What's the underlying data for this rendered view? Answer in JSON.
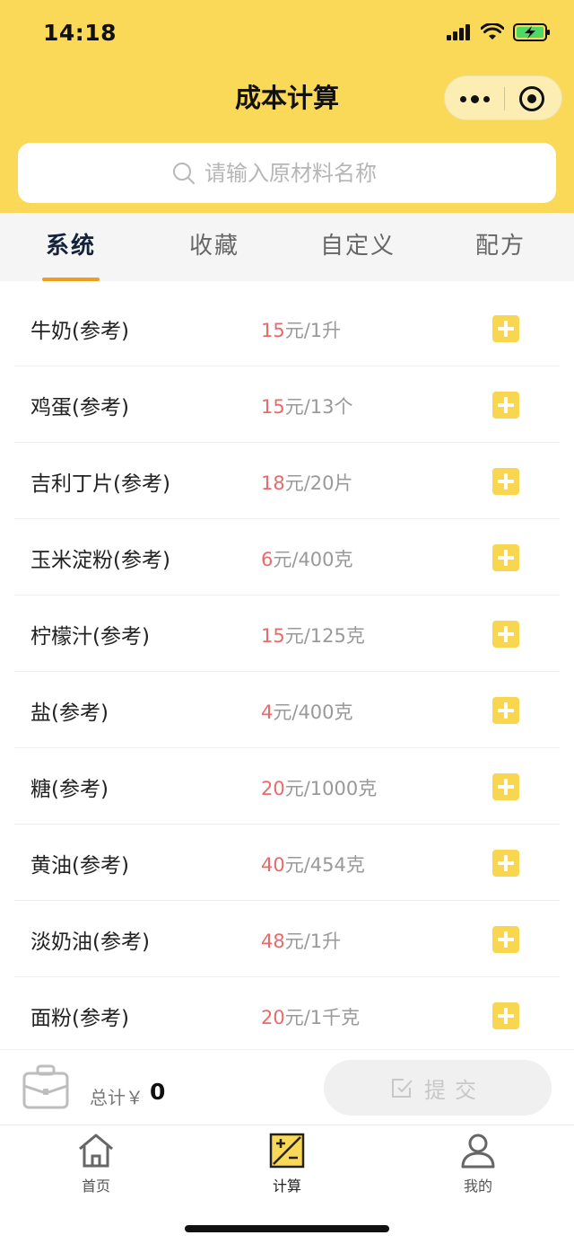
{
  "status_bar": {
    "time": "14:18"
  },
  "header": {
    "title": "成本计算"
  },
  "search": {
    "placeholder": "请输入原材料名称"
  },
  "tabs": [
    {
      "label": "系统",
      "active": true
    },
    {
      "label": "收藏",
      "active": false
    },
    {
      "label": "自定义",
      "active": false
    },
    {
      "label": "配方",
      "active": false
    }
  ],
  "materials": [
    {
      "name": "牛奶(参考)",
      "price": "15",
      "unit": "元/1升"
    },
    {
      "name": "鸡蛋(参考)",
      "price": "15",
      "unit": "元/13个"
    },
    {
      "name": "吉利丁片(参考)",
      "price": "18",
      "unit": "元/20片"
    },
    {
      "name": "玉米淀粉(参考)",
      "price": "6",
      "unit": "元/400克"
    },
    {
      "name": "柠檬汁(参考)",
      "price": "15",
      "unit": "元/125克"
    },
    {
      "name": "盐(参考)",
      "price": "4",
      "unit": "元/400克"
    },
    {
      "name": "糖(参考)",
      "price": "20",
      "unit": "元/1000克"
    },
    {
      "name": "黄油(参考)",
      "price": "40",
      "unit": "元/454克"
    },
    {
      "name": "淡奶油(参考)",
      "price": "48",
      "unit": "元/1升"
    },
    {
      "name": "面粉(参考)",
      "price": "20",
      "unit": "元/1千克"
    }
  ],
  "cart": {
    "total_label": "总计￥",
    "total_value": "0",
    "submit_label": "提交"
  },
  "tabbar": [
    {
      "label": "首页",
      "icon": "home-icon",
      "active": false
    },
    {
      "label": "计算",
      "icon": "calculator-icon",
      "active": true
    },
    {
      "label": "我的",
      "icon": "user-icon",
      "active": false
    }
  ],
  "colors": {
    "brand_yellow": "#f9d957",
    "accent_orange": "#f29c1f",
    "price_red": "#e86a6a"
  }
}
